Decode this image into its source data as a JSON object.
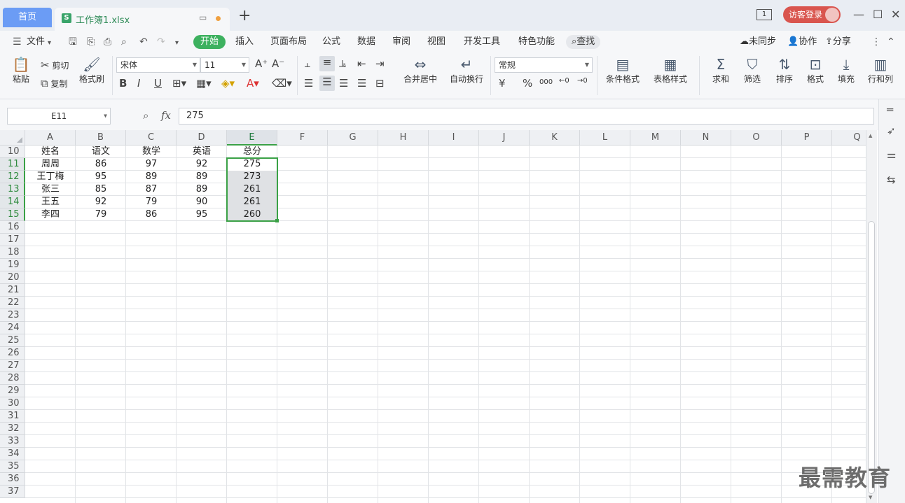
{
  "titlebar": {
    "home_tab": "首页",
    "doc_tab": "工作簿1.xlsx",
    "doc_icon": "S",
    "new_tab": "+",
    "page_index": "1",
    "login_label": "访客登录",
    "min": "—",
    "max": "☐",
    "close": "✕"
  },
  "menubar": {
    "file": "文件",
    "tabs": [
      "开始",
      "插入",
      "页面布局",
      "公式",
      "数据",
      "审阅",
      "视图",
      "开发工具",
      "特色功能"
    ],
    "search": "查找",
    "sync": "未同步",
    "collab": "协作",
    "share": "分享"
  },
  "ribbon": {
    "paste": "粘贴",
    "cut": "剪切",
    "copy": "复制",
    "format_painter": "格式刷",
    "font_name": "宋体",
    "font_size": "11",
    "bold": "B",
    "italic": "I",
    "underline": "U",
    "merge_center": "合并居中",
    "wrap_text": "自动换行",
    "number_format": "常规",
    "currency": "¥",
    "percent": "%",
    "thousands": "000",
    "cond_format": "条件格式",
    "table_style": "表格样式",
    "sum": "求和",
    "filter": "筛选",
    "sort": "排序",
    "format": "格式",
    "fill": "填充",
    "row_col": "行和列"
  },
  "formula": {
    "cell_ref": "E11",
    "fx": "fx",
    "value": "275"
  },
  "columns": [
    "A",
    "B",
    "C",
    "D",
    "E",
    "F",
    "G",
    "H",
    "I",
    "J",
    "K",
    "L",
    "M",
    "N",
    "O",
    "P",
    "Q"
  ],
  "rows": [
    "10",
    "11",
    "12",
    "13",
    "14",
    "15",
    "16",
    "17",
    "18",
    "19",
    "20",
    "21",
    "22",
    "23",
    "24",
    "25",
    "26",
    "27",
    "28",
    "29",
    "30",
    "31",
    "32",
    "33",
    "34",
    "35",
    "36",
    "37"
  ],
  "table": [
    [
      "姓名",
      "语文",
      "数学",
      "英语",
      "总分"
    ],
    [
      "周周",
      "86",
      "97",
      "92",
      "275"
    ],
    [
      "王丁梅",
      "95",
      "89",
      "89",
      "273"
    ],
    [
      "张三",
      "85",
      "87",
      "89",
      "261"
    ],
    [
      "王五",
      "92",
      "79",
      "90",
      "261"
    ],
    [
      "李四",
      "79",
      "86",
      "95",
      "260"
    ]
  ],
  "watermark": "最需教育",
  "colors": {
    "accent": "#3aa146",
    "home_tab": "#6b9cf5",
    "login": "#d9554e"
  }
}
